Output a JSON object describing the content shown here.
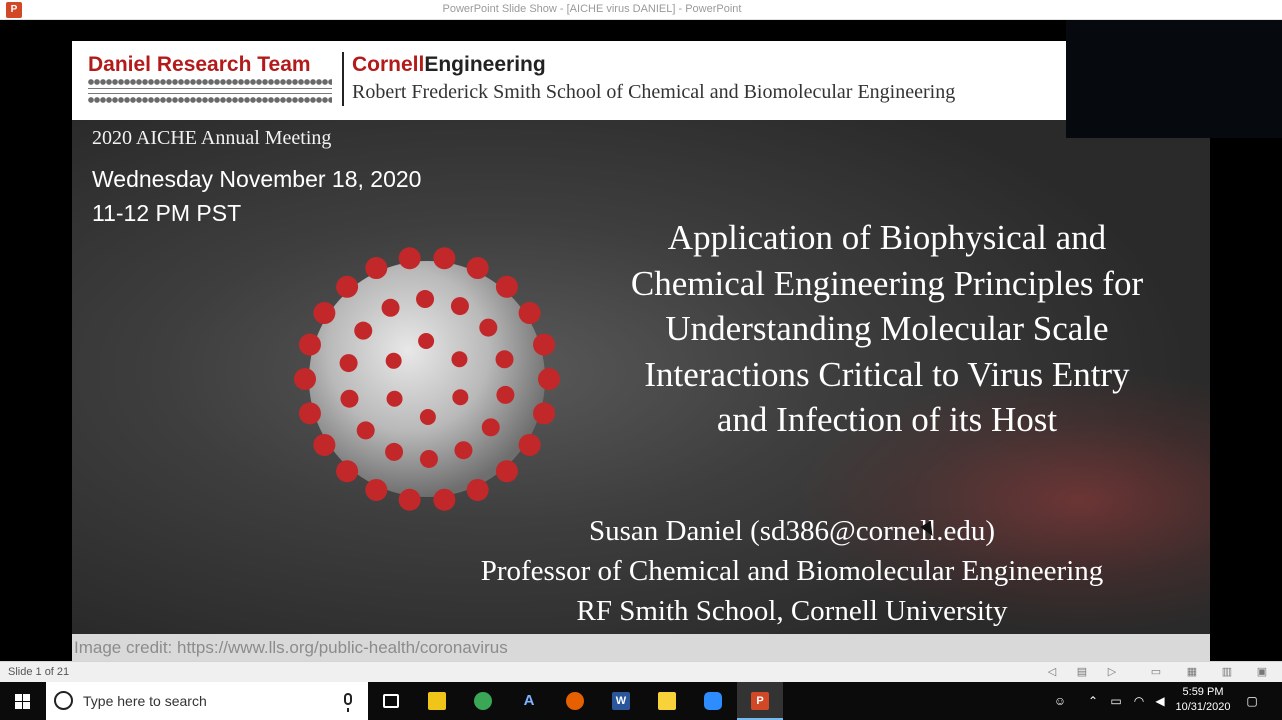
{
  "window": {
    "title": "PowerPoint Slide Show - [AICHE virus DANIEL] - PowerPoint",
    "app_icon": "powerpoint-icon"
  },
  "slide": {
    "header": {
      "team_name": "Daniel Research Team",
      "brand_part1": "Cornell",
      "brand_part2": "Engineering",
      "school_name": "Robert Frederick Smith School of Chemical and Biomolecular Engineering"
    },
    "meeting_name": "2020 AICHE Annual Meeting",
    "meeting_date": "Wednesday November 18, 2020",
    "meeting_time": "11-12 PM PST",
    "title_lines": [
      "Application of Biophysical and",
      "Chemical Engineering Principles for",
      "Understanding Molecular Scale",
      "Interactions Critical to Virus Entry",
      "and Infection of its Host"
    ],
    "speaker_lines": [
      "Susan Daniel (sd386@cornell.edu)",
      "Professor of Chemical and Biomolecular Engineering",
      "RF Smith School, Cornell University"
    ],
    "image_credit": "Image credit: https://www.lls.org/public-health/coronavirus",
    "colors": {
      "cornell_red": "#b31b1b",
      "virus_spike": "#c2282a"
    }
  },
  "status_bar": {
    "slide_counter": "Slide 1 of 21",
    "buttons": [
      "previous-icon",
      "slide-menu-icon",
      "next-icon",
      "normal-view-icon",
      "slide-sorter-icon",
      "reading-view-icon",
      "slideshow-icon"
    ]
  },
  "taskbar": {
    "search_placeholder": "Type here to search",
    "apps": [
      {
        "name": "task-view",
        "glyph": "▭",
        "color": "#0b0b0b"
      },
      {
        "name": "file-explorer",
        "glyph": "",
        "color": "#f0c419"
      },
      {
        "name": "chrome",
        "glyph": "",
        "color": "#3aa757"
      },
      {
        "name": "acrobat",
        "glyph": "A",
        "color": "#0b0b0b"
      },
      {
        "name": "firefox",
        "glyph": "",
        "color": "#e66000"
      },
      {
        "name": "word",
        "glyph": "W",
        "color": "#2b579a"
      },
      {
        "name": "sticky-notes",
        "glyph": "",
        "color": "#f7d339"
      },
      {
        "name": "zoom",
        "glyph": "",
        "color": "#2d8cff"
      },
      {
        "name": "powerpoint",
        "glyph": "P",
        "color": "#d24726"
      }
    ],
    "tray": {
      "time": "5:59 PM",
      "date": "10/31/2020"
    }
  }
}
